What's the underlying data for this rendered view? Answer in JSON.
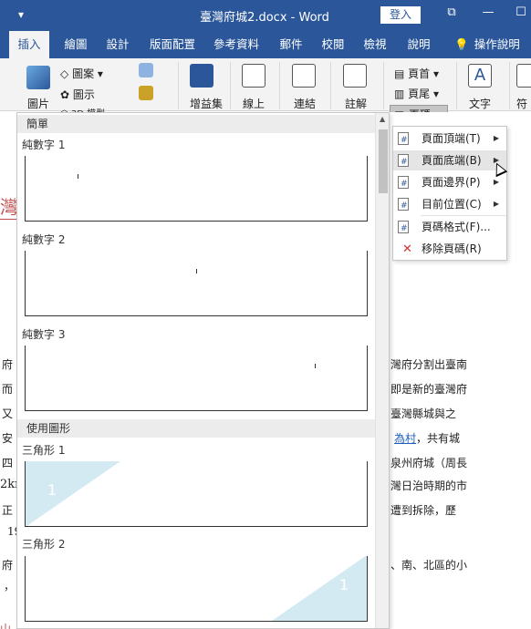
{
  "titlebar": {
    "quick_access": "▾",
    "title": "臺灣府城2.docx - Word",
    "login": "登入",
    "restore": "⧉",
    "minimize": "—",
    "maximize": "☐"
  },
  "tabs": [
    "插入",
    "繪圖",
    "設計",
    "版面配置",
    "參考資料",
    "郵件",
    "校閱",
    "檢視",
    "說明",
    "操作說明"
  ],
  "ribbon": {
    "picture": "圖片",
    "shapes": "圖案",
    "smartart": "圖示",
    "models": "3D 模型",
    "addins": "增益集",
    "online_video": "線上",
    "link": "連結",
    "comment": "註解",
    "header": "頁首",
    "footer": "頁尾",
    "page_number": "頁碼",
    "text": "文字",
    "symbol": "符號"
  },
  "gallery": {
    "section_simple": "簡單",
    "plain1": "純數字 1",
    "plain2": "純數字 2",
    "plain3": "純數字 3",
    "section_shapes": "使用圖形",
    "tri1": "三角形 1",
    "tri2": "三角形 2",
    "tri_num": "1"
  },
  "menu": {
    "top": "頁面頂端(T)",
    "bottom": "頁面底端(B)",
    "margins": "頁面邊界(P)",
    "current": "目前位置(C)",
    "format": "頁碼格式(F)...",
    "remove": "移除頁碼(R)"
  },
  "doc": {
    "heading_frag": "灣",
    "line1": "灣府分割出臺南",
    "line2": "即是新的臺灣府",
    "line3": "臺灣縣城與之",
    "line4_link": "為村",
    "line4_rest": "，共有城",
    "line5": "泉州府城（周長",
    "line6": "灣日治時期的市",
    "line7": "遭到拆除，歷",
    "line8": "、南、北區的小",
    "left1": "府",
    "left2": "而",
    "left3": "又",
    "left4": "安",
    "left5": "四",
    "left6": "2kr",
    "left7": "正",
    "left8": "19",
    "left9": "府",
    "left10": "，",
    "left11": "山"
  },
  "colors": {
    "accent": "#2b579a",
    "tri_fill": "#d4eaf3"
  }
}
